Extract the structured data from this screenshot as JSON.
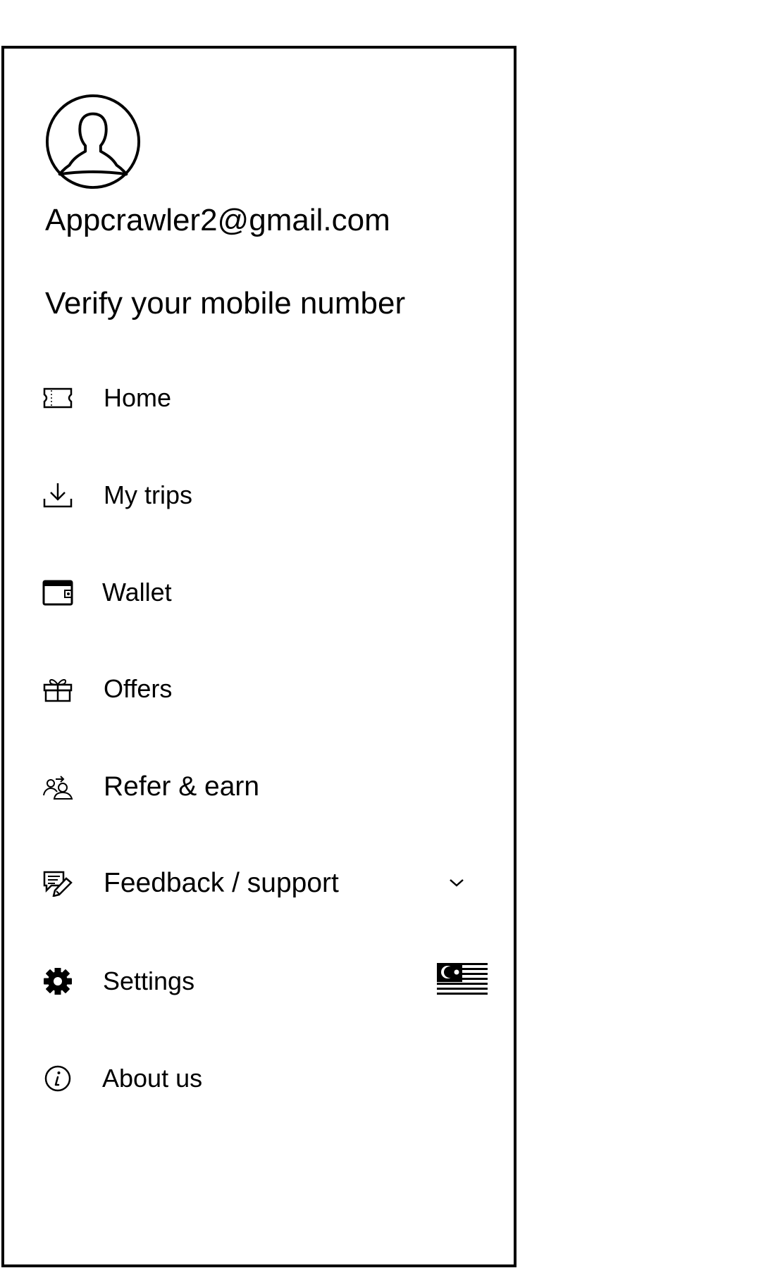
{
  "profile": {
    "email": "Appcrawler2@gmail.com",
    "verify_text": "Verify your mobile number"
  },
  "menu": {
    "items": [
      {
        "label": "Home",
        "icon": "ticket-icon"
      },
      {
        "label": "My trips",
        "icon": "download-icon"
      },
      {
        "label": "Wallet",
        "icon": "wallet-icon"
      },
      {
        "label": "Offers",
        "icon": "gift-icon"
      },
      {
        "label": "Refer & earn",
        "icon": "refer-users-icon"
      },
      {
        "label": "Feedback / support",
        "icon": "feedback-edit-icon",
        "expandable": true
      },
      {
        "label": "Settings",
        "icon": "gear-icon"
      },
      {
        "label": "About us",
        "icon": "info-icon"
      }
    ]
  },
  "language": {
    "flag_icon": "malaysia-flag-icon"
  },
  "colors": {
    "foreground": "#000000",
    "background": "#ffffff"
  }
}
